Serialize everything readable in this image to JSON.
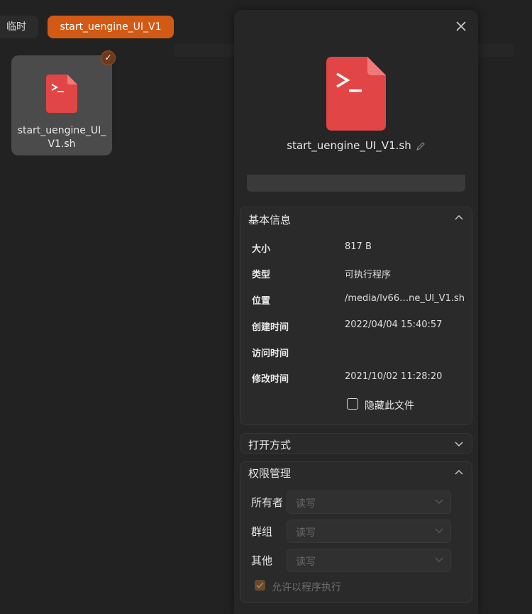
{
  "tabs": [
    {
      "label": "临时"
    },
    {
      "label": "start_uengine_UI_V1"
    }
  ],
  "file_tile": {
    "name": "start_uengine_UI_V1.sh",
    "selected": true
  },
  "panel": {
    "file_name": "start_uengine_UI_V1.sh",
    "basic_info": {
      "title": "基本信息",
      "rows": [
        {
          "key": "大小",
          "value": "817 B"
        },
        {
          "key": "类型",
          "value": "可执行程序"
        },
        {
          "key": "位置",
          "value": "/media/lv66…ne_UI_V1.sh"
        },
        {
          "key": "创建时间",
          "value": "2022/04/04 15:40:57"
        },
        {
          "key": "访问时间",
          "value": ""
        },
        {
          "key": "修改时间",
          "value": "2021/10/02 11:28:20"
        }
      ],
      "hide_file_label": "隐藏此文件"
    },
    "open_with": {
      "title": "打开方式"
    },
    "permissions": {
      "title": "权限管理",
      "rows": [
        {
          "label": "所有者",
          "value": "读写"
        },
        {
          "label": "群组",
          "value": "读写"
        },
        {
          "label": "其他",
          "value": "读写"
        }
      ],
      "allow_exec_label": "允许以程序执行"
    }
  },
  "colors": {
    "accent": "#d35a15",
    "file_icon_red": "#e24545",
    "background": "#222222"
  }
}
